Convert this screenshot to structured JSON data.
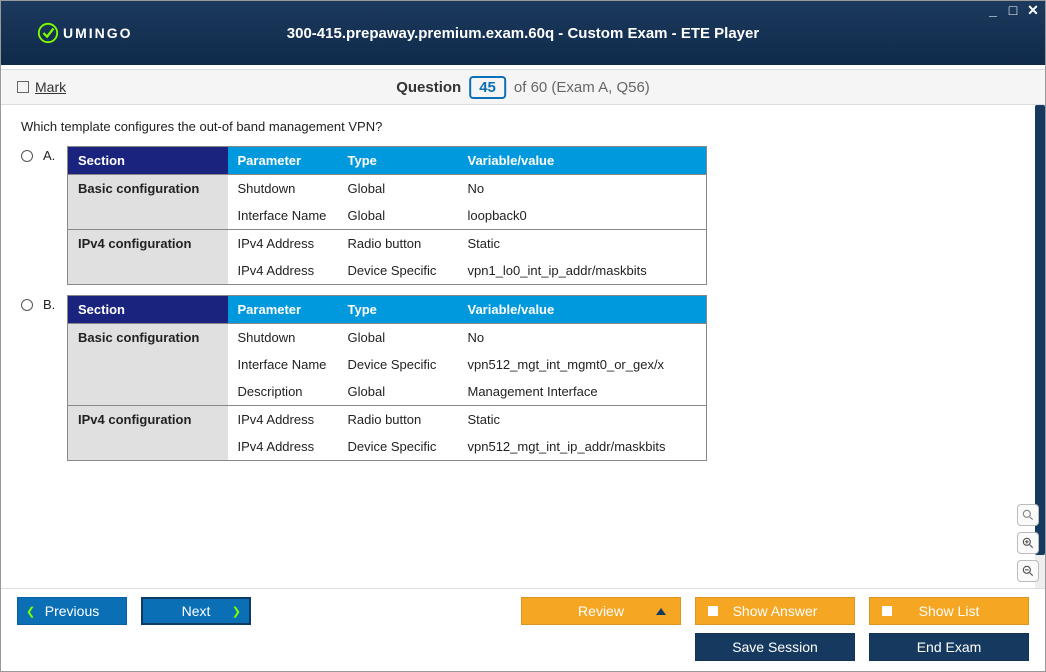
{
  "window": {
    "title": "300-415.prepaway.premium.exam.60q - Custom Exam - ETE Player",
    "brand": "UMINGO"
  },
  "question_bar": {
    "mark": "Mark",
    "word": "Question",
    "current": "45",
    "rest": "of 60 (Exam A, Q56)"
  },
  "question": {
    "text": "Which template configures the out-of band management VPN?"
  },
  "options": {
    "a": {
      "letter": "A.",
      "headers": {
        "section": "Section",
        "parameter": "Parameter",
        "type": "Type",
        "varval": "Variable/value"
      },
      "sections": [
        {
          "name": "Basic configuration",
          "rows": [
            {
              "param": "Shutdown",
              "type": "Global",
              "val": "No"
            },
            {
              "param": "Interface Name",
              "type": "Global",
              "val": "loopback0"
            }
          ]
        },
        {
          "name": "IPv4 configuration",
          "rows": [
            {
              "param": "IPv4 Address",
              "type": "Radio button",
              "val": "Static"
            },
            {
              "param": "IPv4 Address",
              "type": "Device Specific",
              "val": "vpn1_lo0_int_ip_addr/maskbits"
            }
          ]
        }
      ]
    },
    "b": {
      "letter": "B.",
      "headers": {
        "section": "Section",
        "parameter": "Parameter",
        "type": "Type",
        "varval": "Variable/value"
      },
      "sections": [
        {
          "name": "Basic configuration",
          "rows": [
            {
              "param": "Shutdown",
              "type": "Global",
              "val": "No"
            },
            {
              "param": "Interface Name",
              "type": "Device Specific",
              "val": "vpn512_mgt_int_mgmt0_or_gex/x"
            },
            {
              "param": "Description",
              "type": "Global",
              "val": "Management Interface"
            }
          ]
        },
        {
          "name": "IPv4 configuration",
          "rows": [
            {
              "param": "IPv4 Address",
              "type": "Radio button",
              "val": "Static"
            },
            {
              "param": "IPv4 Address",
              "type": "Device Specific",
              "val": "vpn512_mgt_int_ip_addr/maskbits"
            }
          ]
        }
      ]
    }
  },
  "footer": {
    "previous": "Previous",
    "next": "Next",
    "review": "Review",
    "show_answer": "Show Answer",
    "show_list": "Show List",
    "save_session": "Save Session",
    "end_exam": "End Exam"
  }
}
